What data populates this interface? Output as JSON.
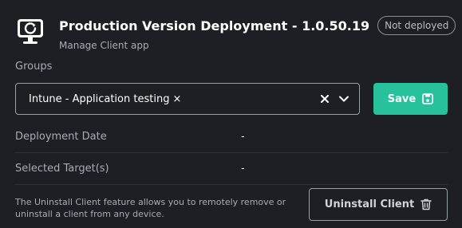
{
  "header": {
    "title": "Production Version Deployment - 1.0.50.19",
    "status_badge": "Not deployed",
    "subtitle": "Manage Client app",
    "icon": "monitor-refresh-icon"
  },
  "groups": {
    "label": "Groups",
    "selected": [
      {
        "label": "Intune - Application testing",
        "remove_symbol": "×"
      }
    ]
  },
  "actions": {
    "save_label": "Save",
    "uninstall_label": "Uninstall Client"
  },
  "details": {
    "deployment_date_label": "Deployment Date",
    "deployment_date_value": "-",
    "selected_targets_label": "Selected Target(s)",
    "selected_targets_value": "-"
  },
  "footer": {
    "description": "The Uninstall Client feature allows you to remotely remove or uninstall a client from any device."
  },
  "colors": {
    "background": "#1d1f24",
    "accent": "#27c29b",
    "muted_text": "#a8acb4",
    "border": "#9aa0a8"
  }
}
